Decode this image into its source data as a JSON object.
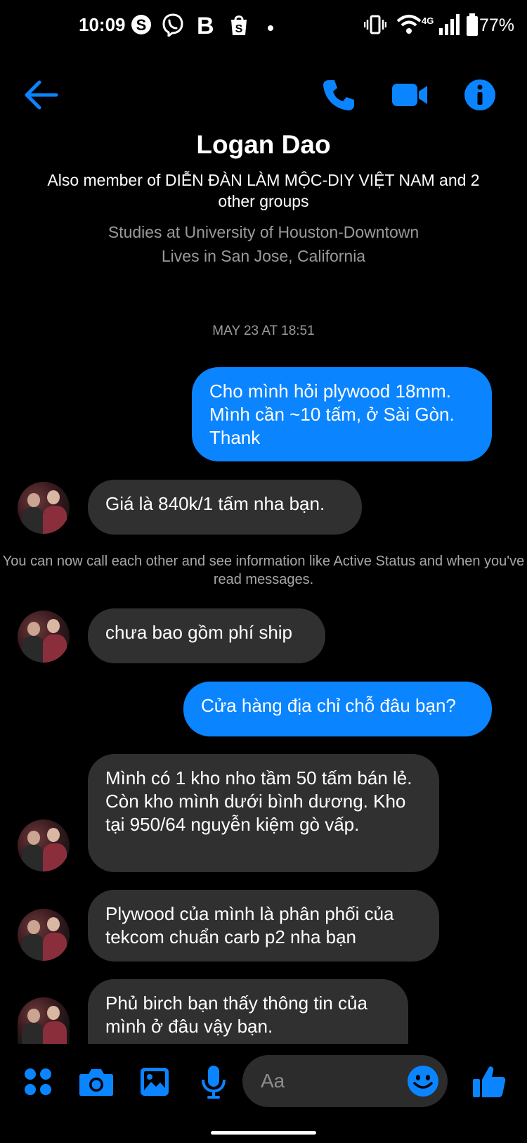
{
  "status_bar": {
    "time": "10:09",
    "network": "4G",
    "battery": "77%"
  },
  "contact": {
    "name": "Logan Dao",
    "groups": "Also member of DIỄN ĐÀN LÀM MỘC-DIY VIỆT NAM and 2 other groups",
    "study": "Studies at University of Houston-Downtown",
    "location": "Lives in San Jose, California"
  },
  "thread": {
    "timestamp": "MAY 23 AT 18:51",
    "system_note": "You can now call each other and see information like Active Status and when you've read messages.",
    "messages": [
      {
        "from": "me",
        "text": "Cho mình hỏi plywood 18mm. Mình cần ~10 tấm, ở Sài Gòn. Thank"
      },
      {
        "from": "them",
        "text": "Giá là 840k/1 tấm nha bạn."
      },
      {
        "from": "them",
        "text": "chưa bao gồm phí ship"
      },
      {
        "from": "me",
        "text": "Cửa hàng địa chỉ chỗ đâu bạn?"
      },
      {
        "from": "them",
        "text": "Mình có 1 kho nho tầm 50 tấm bán lẻ. Còn kho mình dưới bình dương. Kho tại 950/64 nguyễn kiệm gò vấp."
      },
      {
        "from": "them",
        "text": "Plywood của mình là phân phối của tekcom chuẩn carb p2 nha bạn"
      },
      {
        "from": "them",
        "text": "Phủ birch bạn thấy thông tin của mình ở đâu vậy bạn."
      }
    ]
  },
  "composer": {
    "placeholder": "Aa"
  },
  "colors": {
    "accent": "#0a84ff",
    "incoming_bubble": "#303030",
    "background": "#000000"
  },
  "icons": [
    "back-arrow-icon",
    "phone-icon",
    "video-camera-icon",
    "info-icon",
    "apps-grid-icon",
    "camera-icon",
    "gallery-icon",
    "microphone-icon",
    "emoji-icon",
    "thumbs-up-icon"
  ]
}
